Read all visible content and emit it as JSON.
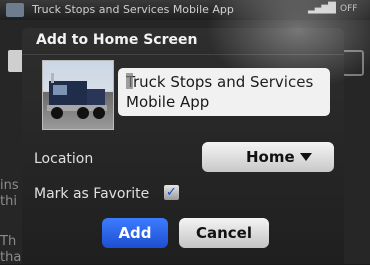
{
  "statusbar": {
    "app_name": "Truck Stops and Services Mobile App",
    "radio": "OFF",
    "signal_icon": "signal-icon",
    "battery_icon": "battery-icon"
  },
  "background": {
    "left_line_1": "ins",
    "left_line_2": "thi",
    "left_line_3": "Th",
    "left_line_4": "tha"
  },
  "dialog": {
    "title": "Add to Home Screen",
    "name_value": "Truck Stops and Services Mobile App",
    "location_label": "Location",
    "location_value": "Home",
    "favorite_label": "Mark as Favorite",
    "favorite_checked": true,
    "add_label": "Add",
    "cancel_label": "Cancel"
  },
  "colors": {
    "accent": "#2a63e6",
    "dialog_bg": "#2a2a2a"
  }
}
